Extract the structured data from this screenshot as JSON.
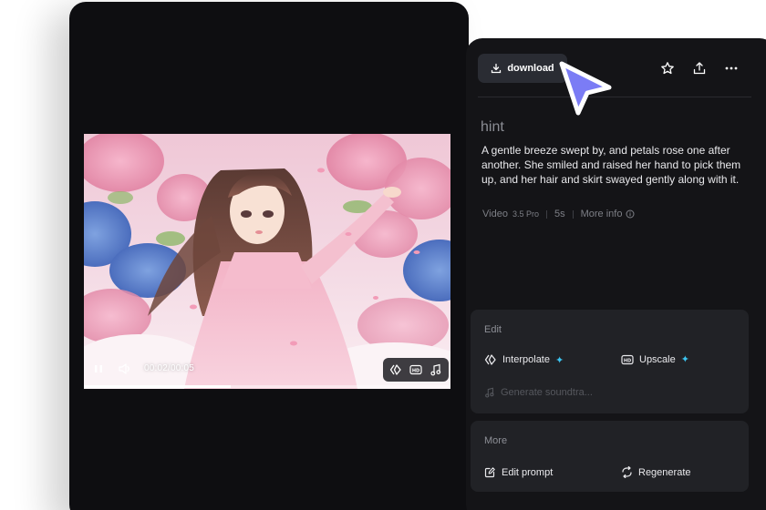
{
  "player": {
    "time": "00:02/00:05",
    "progress": 0.4,
    "play_state_icon": "pause-icon",
    "volume_icon": "volume-icon",
    "tools": [
      "interpolate-icon",
      "hd-icon",
      "music-icon"
    ]
  },
  "toolbar": {
    "download_label": "download",
    "actions": [
      "star-icon",
      "share-icon",
      "more-icon"
    ]
  },
  "details": {
    "title": "hint",
    "prompt": "A gentle breeze swept by, and petals rose one after another. She smiled and raised her hand to pick them up, and her hair and skirt swayed gently along with it.",
    "meta": {
      "type": "Video",
      "model": "3.5 Pro",
      "duration": "5s",
      "more_info": "More info"
    }
  },
  "edit": {
    "title": "Edit",
    "interpolate": "Interpolate",
    "upscale": "Upscale",
    "soundtrack": "Generate soundtra..."
  },
  "more": {
    "title": "More",
    "edit_prompt": "Edit prompt",
    "regenerate": "Regenerate"
  },
  "colors": {
    "panel_bg": "#141417",
    "video_panel_bg": "#0e0e11",
    "card_bg": "#212226",
    "accent_spark": "#3cc4f0",
    "cursor": "#7b7cf5"
  }
}
